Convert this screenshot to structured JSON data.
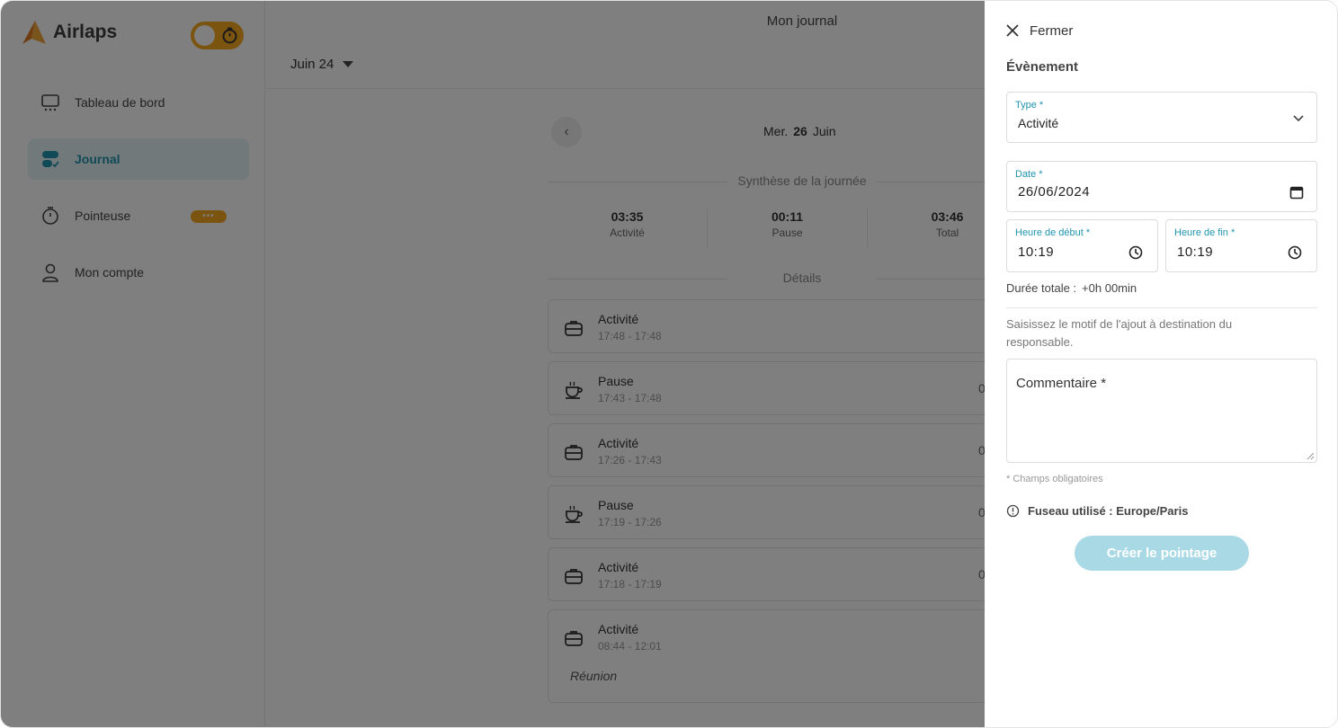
{
  "app": {
    "name": "Airlaps"
  },
  "header": {
    "title": "Mon journal",
    "month_selector": "Juin 24"
  },
  "sidebar": {
    "items": [
      {
        "label": "Tableau de bord",
        "icon": "dashboard-icon",
        "active": false
      },
      {
        "label": "Journal",
        "icon": "journal-icon",
        "active": true
      },
      {
        "label": "Pointeuse",
        "icon": "stopwatch-icon",
        "active": false,
        "badge": "•••"
      },
      {
        "label": "Mon compte",
        "icon": "user-icon",
        "active": false
      }
    ]
  },
  "day": {
    "prefix": "Mer.",
    "number": "26",
    "month": "Juin"
  },
  "summary": {
    "title": "Synthèse de la journée",
    "stats": [
      {
        "value": "03:35",
        "label": "Activité"
      },
      {
        "value": "00:11",
        "label": "Pause"
      },
      {
        "value": "03:46",
        "label": "Total"
      }
    ]
  },
  "details": {
    "title": "Détails",
    "entries": [
      {
        "type": "Activité",
        "time": "17:48 - 17:48",
        "icon": "briefcase-icon",
        "right": ""
      },
      {
        "type": "Pause",
        "time": "17:43 - 17:48",
        "icon": "coffee-icon",
        "right": "0"
      },
      {
        "type": "Activité",
        "time": "17:26 - 17:43",
        "icon": "briefcase-icon",
        "right": "0"
      },
      {
        "type": "Pause",
        "time": "17:19 - 17:26",
        "icon": "coffee-icon",
        "right": "0"
      },
      {
        "type": "Activité",
        "time": "17:18 - 17:19",
        "icon": "briefcase-icon",
        "right": "0"
      },
      {
        "type": "Activité",
        "time": "08:44 - 12:01",
        "icon": "briefcase-icon",
        "right": "",
        "note": "Réunion"
      }
    ]
  },
  "drawer": {
    "close_label": "Fermer",
    "title": "Évènement",
    "type_field": {
      "label": "Type *",
      "value": "Activité"
    },
    "date_field": {
      "label": "Date *",
      "value": "26/06/2024"
    },
    "start_field": {
      "label": "Heure de début *",
      "value": "10:19"
    },
    "end_field": {
      "label": "Heure de fin *",
      "value": "10:19"
    },
    "duration_label": "Durée totale :",
    "duration_value": "+0h 00min",
    "helper": "Saisissez le motif de l'ajout à destination du responsable.",
    "comment_placeholder": "Commentaire *",
    "required_note": "* Champs obligatoires",
    "timezone": "Fuseau utilisé : Europe/Paris",
    "submit_label": "Créer le pointage"
  },
  "colors": {
    "accent": "#1f94ad",
    "brand_orange": "#f6a821",
    "submit_disabled": "#a9d9e4"
  }
}
